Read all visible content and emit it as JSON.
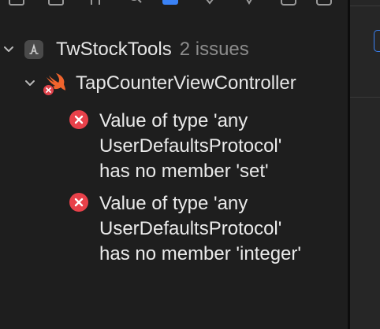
{
  "navigator": {
    "project": {
      "name": "TwStockTools",
      "issue_count": "2 issues",
      "icon": "app-store-project-icon",
      "expanded": true
    },
    "file": {
      "name": "TapCounterViewController",
      "icon": "swift-file-icon",
      "badge": "error-badge-icon",
      "expanded": true
    },
    "issues": [
      {
        "type": "error",
        "icon": "error-x-icon",
        "lines": [
          "Value of type 'any",
          "UserDefaultsProtocol'",
          "has no member 'set'"
        ]
      },
      {
        "type": "error",
        "icon": "error-x-icon",
        "lines": [
          "Value of type 'any",
          "UserDefaultsProtocol'",
          "has no member 'integer'"
        ]
      }
    ]
  },
  "colors": {
    "background": "#1e1e1e",
    "text": "#e6e6e6",
    "muted": "#8c8c8c",
    "error": "#e8414a",
    "accent": "#3a82f6"
  }
}
